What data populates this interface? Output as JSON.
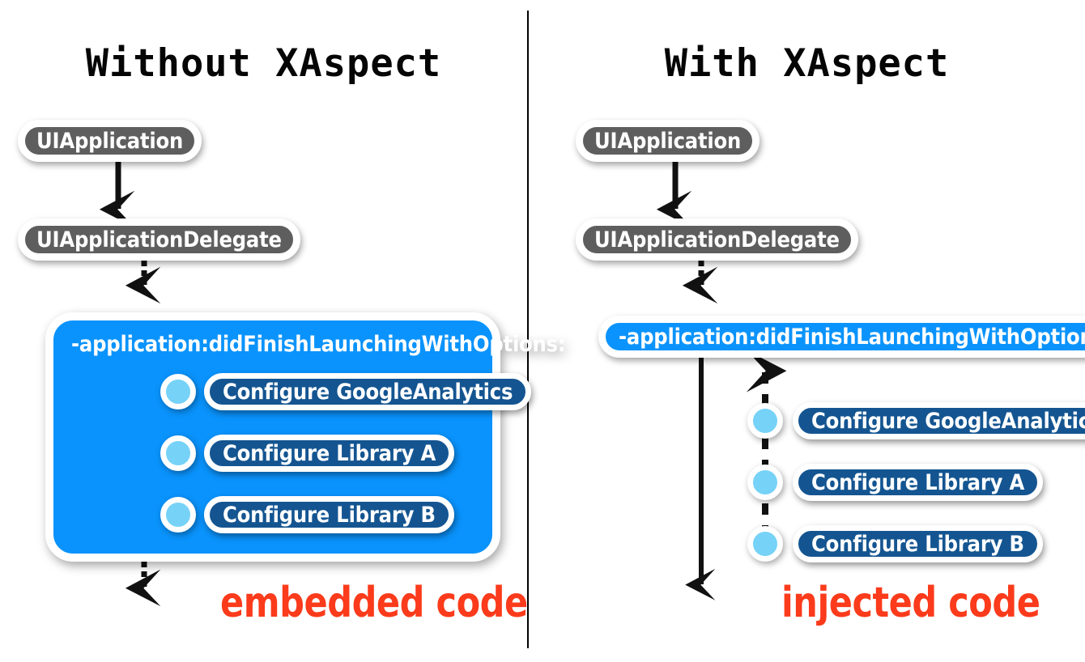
{
  "figure": {
    "background_color": "#ffffff",
    "divider_color": "#000000"
  },
  "panels": [
    {
      "id": "without-xaspect",
      "title": "Without XAspect",
      "caption": "embedded code",
      "caption_color": "#fb3b1b",
      "nodes": [
        {
          "label": "UIApplication",
          "style": "gray"
        },
        {
          "label": "UIApplicationDelegate",
          "style": "gray"
        }
      ],
      "code_box": {
        "method_label": "-application:didFinishLaunchingWithOptions:",
        "background_color": "#0a93fc",
        "items": [
          {
            "label": "Configure GoogleAnalytics",
            "bullet_color": "#76d2f7",
            "pill_color": "#145591"
          },
          {
            "label": "Configure Library A",
            "bullet_color": "#76d2f7",
            "pill_color": "#145591"
          },
          {
            "label": "Configure Library B",
            "bullet_color": "#76d2f7",
            "pill_color": "#145591"
          }
        ]
      }
    },
    {
      "id": "with-xaspect",
      "title": "With XAspect",
      "caption": "injected code",
      "caption_color": "#fb3b1b",
      "nodes": [
        {
          "label": "UIApplication",
          "style": "gray"
        },
        {
          "label": "UIApplicationDelegate",
          "style": "gray"
        }
      ],
      "method_pill": {
        "label": "-application:didFinishLaunchingWithOptions:",
        "background_color": "#0a93fc"
      },
      "items": [
        {
          "label": "Configure GoogleAnalytics",
          "bullet_color": "#76d2f7",
          "pill_color": "#145591"
        },
        {
          "label": "Configure Library A",
          "bullet_color": "#76d2f7",
          "pill_color": "#145591"
        },
        {
          "label": "Configure Library B",
          "bullet_color": "#76d2f7",
          "pill_color": "#145591"
        }
      ]
    }
  ]
}
